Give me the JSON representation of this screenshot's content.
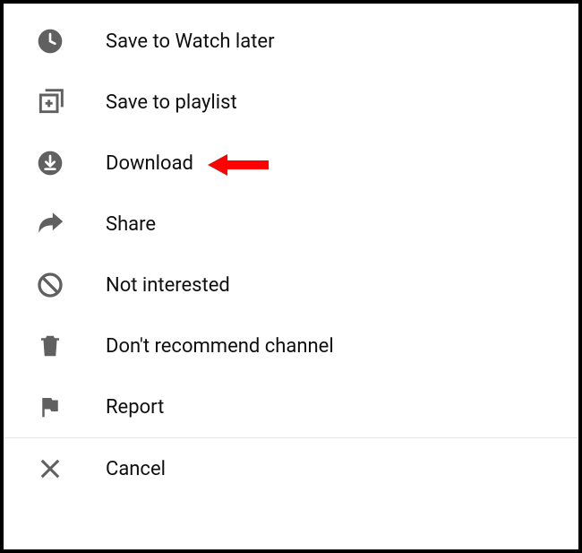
{
  "menu": {
    "items": [
      {
        "label": "Save to Watch later",
        "icon": "clock"
      },
      {
        "label": "Save to playlist",
        "icon": "playlist-add"
      },
      {
        "label": "Download",
        "icon": "download",
        "highlighted": true
      },
      {
        "label": "Share",
        "icon": "share"
      },
      {
        "label": "Not interested",
        "icon": "not-interested"
      },
      {
        "label": "Don't recommend channel",
        "icon": "trash"
      },
      {
        "label": "Report",
        "icon": "flag"
      }
    ],
    "cancel_label": "Cancel"
  },
  "annotation": {
    "arrow_color": "#ff0000",
    "points_to": "download"
  }
}
